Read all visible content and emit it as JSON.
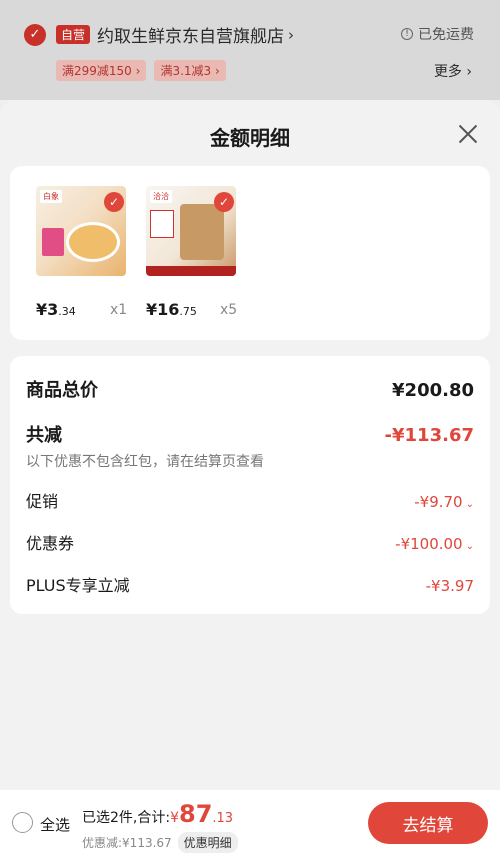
{
  "store": {
    "self_badge": "自营",
    "name": "约取生鲜京东自营旗舰店",
    "arrow": "›",
    "shipping": "已免运费",
    "promo_tags": [
      "满299减150 ›",
      "满3.1减3 ›"
    ],
    "more": "更多 ›"
  },
  "sheet": {
    "title": "金额明细",
    "products": [
      {
        "brand": "白象",
        "price_int": "¥3",
        "price_dec": ".34",
        "qty": "x1"
      },
      {
        "brand": "洽洽",
        "price_int": "¥16",
        "price_dec": ".75",
        "qty": "x5"
      }
    ],
    "summary": {
      "total_label": "商品总价",
      "total_value": "¥200.80",
      "reduce_label": "共减",
      "reduce_value": "-¥113.67",
      "note": "以下优惠不包含红包，请在结算页查看",
      "items": [
        {
          "label": "促销",
          "value": "-¥9.70"
        },
        {
          "label": "优惠券",
          "value": "-¥100.00"
        },
        {
          "label": "PLUS专享立减",
          "value": "-¥3.97"
        }
      ]
    }
  },
  "bottom": {
    "select_all": "全选",
    "selected_text": "已选2件,合计:",
    "currency": "¥",
    "total_int": "87",
    "total_dec": ".13",
    "discount_text": "优惠减:¥113.67",
    "detail_label": "优惠明细",
    "checkout_label": "去结算"
  },
  "colors": {
    "accent": "#e0463a",
    "badge": "#c8302a"
  }
}
